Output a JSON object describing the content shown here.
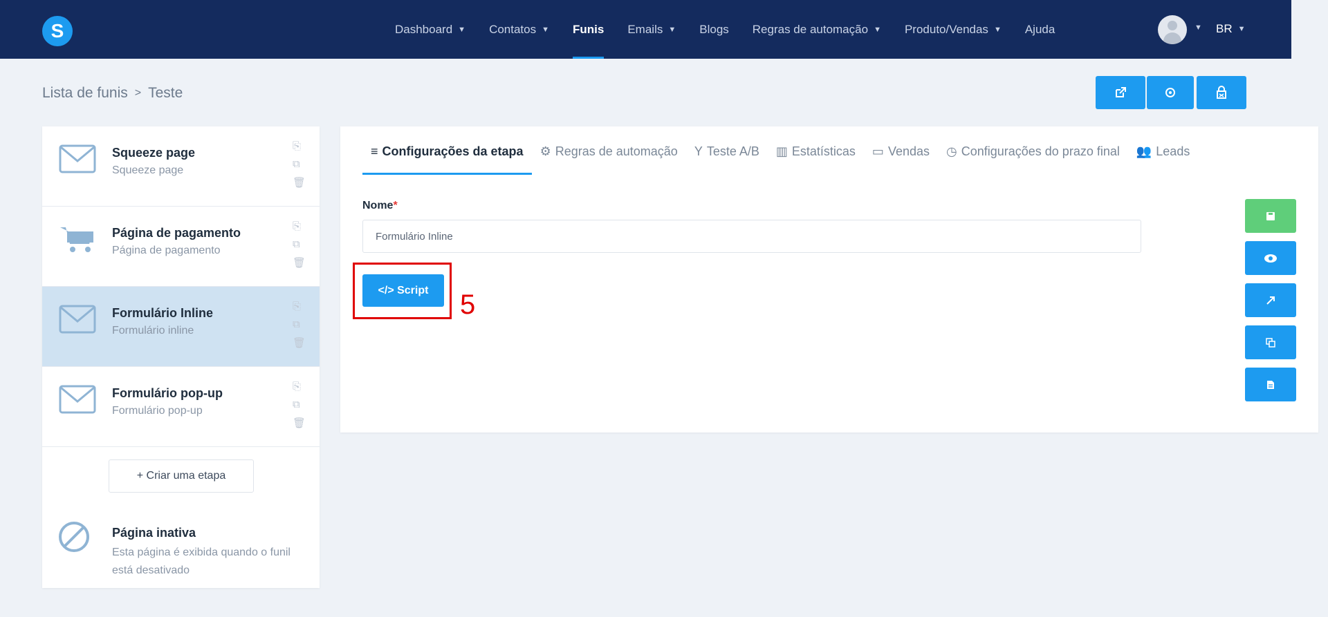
{
  "app": {
    "logo_letter": "S",
    "brand_color": "#1d9bf0",
    "nav_bg": "#142b5e"
  },
  "nav": {
    "items": [
      {
        "label": "Dashboard",
        "has_dropdown": true,
        "active": false
      },
      {
        "label": "Contatos",
        "has_dropdown": true,
        "active": false
      },
      {
        "label": "Funis",
        "has_dropdown": false,
        "active": true
      },
      {
        "label": "Emails",
        "has_dropdown": true,
        "active": false
      },
      {
        "label": "Blogs",
        "has_dropdown": false,
        "active": false
      },
      {
        "label": "Regras de automação",
        "has_dropdown": true,
        "active": false
      },
      {
        "label": "Produto/Vendas",
        "has_dropdown": true,
        "active": false
      },
      {
        "label": "Ajuda",
        "has_dropdown": false,
        "active": false
      }
    ],
    "language": "BR"
  },
  "breadcrumb": {
    "parent": "Lista de funis",
    "current": "Teste"
  },
  "top_actions": {
    "icons": [
      "external-link-icon",
      "settings-icon",
      "shop-icon"
    ]
  },
  "steps": [
    {
      "title": "Squeeze page",
      "subtitle": "Squeeze page",
      "icon": "envelope-icon",
      "active": false
    },
    {
      "title": "Página de pagamento",
      "subtitle": "Página de pagamento",
      "icon": "cart-icon",
      "active": true
    },
    {
      "title": "Formulário Inline",
      "subtitle": "Formulário inline",
      "icon": "envelope-icon",
      "active": true
    },
    {
      "title": "Formulário pop-up",
      "subtitle": "Formulário pop-up",
      "icon": "envelope-icon",
      "active": false
    }
  ],
  "create_step_label": "+ Criar uma etapa",
  "inactive_page": {
    "title": "Página inativa",
    "description": "Esta página é exibida quando o funil está desativado"
  },
  "tabs": [
    {
      "label": "Configurações da etapa",
      "icon": "≡",
      "active": true
    },
    {
      "label": "Regras de automação",
      "icon": "⚙",
      "active": false
    },
    {
      "label": "Teste A/B",
      "icon": "Y",
      "active": false
    },
    {
      "label": "Estatísticas",
      "icon": "▥",
      "active": false
    },
    {
      "label": "Vendas",
      "icon": "▭",
      "active": false
    },
    {
      "label": "Configurações do prazo final",
      "icon": "◷",
      "active": false
    },
    {
      "label": "Leads",
      "icon": "👥",
      "active": false
    }
  ],
  "form": {
    "name_label": "Nome",
    "required_mark": "*",
    "name_value": "Formulário Inline",
    "script_button": "</> Script"
  },
  "annotation": {
    "marker": "5",
    "color": "#e00000"
  },
  "side_actions": {
    "icons": [
      "save-icon",
      "eye-icon",
      "expand-icon",
      "copy-icon",
      "document-icon"
    ]
  }
}
